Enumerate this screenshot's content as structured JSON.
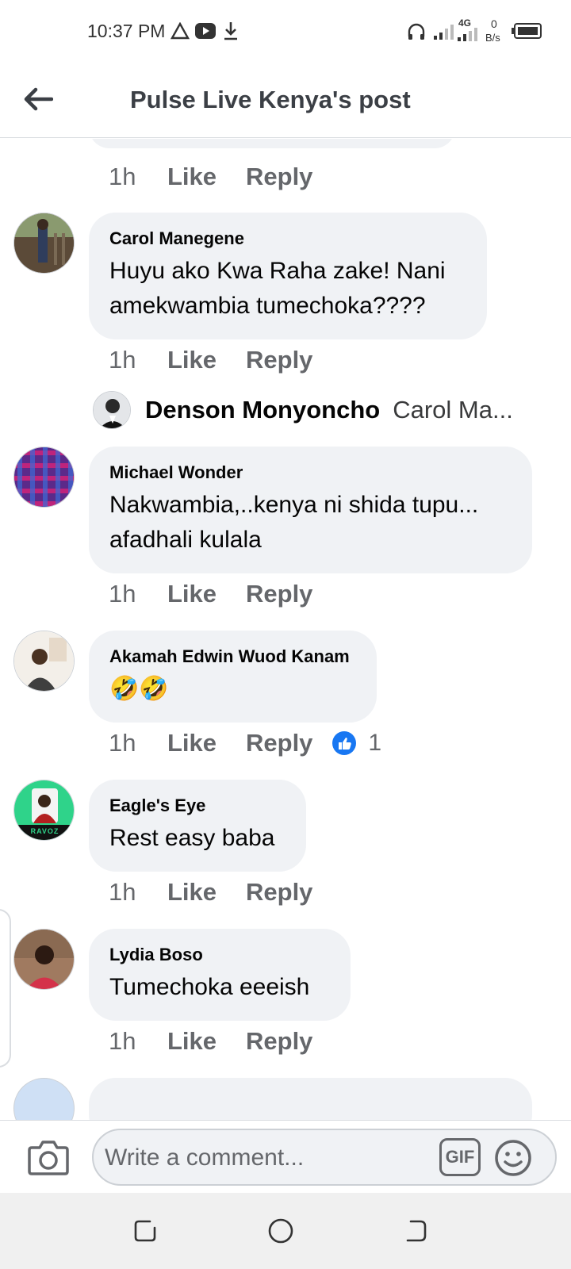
{
  "status_bar": {
    "time": "10:37 PM",
    "network": "4G",
    "speed_value": "0",
    "speed_unit": "B/s"
  },
  "header": {
    "title": "Pulse Live Kenya's post"
  },
  "previous_actions": {
    "time": "1h",
    "like": "Like",
    "reply": "Reply"
  },
  "comments": [
    {
      "author": "Carol Manegene",
      "text_line1": "Huyu ako Kwa Raha zake! Nani",
      "text_line2": "amekwambia tumechoka????",
      "time": "1h",
      "like": "Like",
      "reply": "Reply",
      "reply_preview": {
        "name": "Denson Monyoncho",
        "snippet": "Carol Ma..."
      }
    },
    {
      "author": "Michael Wonder",
      "text_line1": "Nakwambia,..kenya ni shida tupu...",
      "text_line2": "afadhali kulala",
      "time": "1h",
      "like": "Like",
      "reply": "Reply"
    },
    {
      "author": "Akamah Edwin Wuod Kanam",
      "text_line1": "🤣🤣",
      "time": "1h",
      "like": "Like",
      "reply": "Reply",
      "reaction_count": "1"
    },
    {
      "author": "Eagle's Eye",
      "text_line1": "Rest easy baba",
      "avatar_caption": "RAVOZ",
      "time": "1h",
      "like": "Like",
      "reply": "Reply"
    },
    {
      "author": "Lydia Boso",
      "text_line1": "Tumechoka eeeish",
      "time": "1h",
      "like": "Like",
      "reply": "Reply"
    }
  ],
  "composer": {
    "placeholder": "Write a comment...",
    "gif_label": "GIF"
  },
  "colors": {
    "bubble": "#f0f2f5",
    "secondary_text": "#65676b",
    "like_blue": "#1877f2"
  },
  "icons": [
    "back-arrow-icon",
    "camera-icon",
    "gif-icon",
    "emoji-icon",
    "like-reaction-icon",
    "recent-apps-icon",
    "home-icon",
    "back-nav-icon"
  ]
}
